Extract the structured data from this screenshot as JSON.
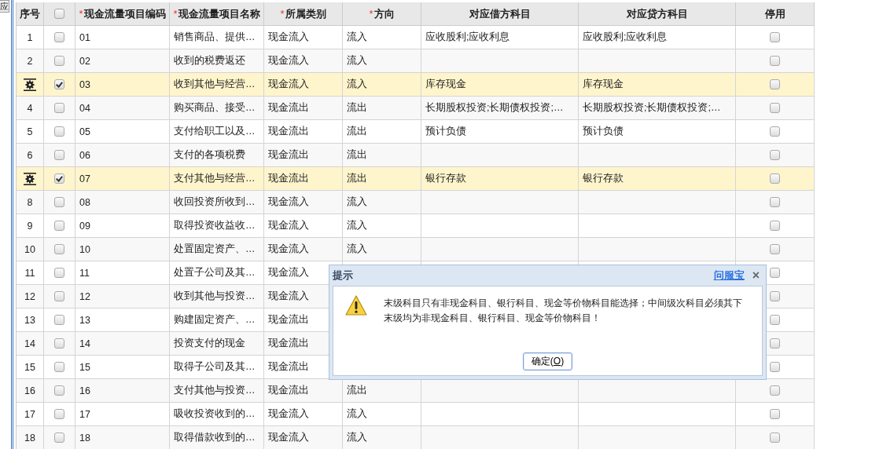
{
  "side_tab": {
    "label": "应"
  },
  "table": {
    "columns": [
      {
        "label": "序号"
      },
      {
        "kind": "checkbox",
        "checked": false
      },
      {
        "label": "现金流量项目编码",
        "required_mark": "*"
      },
      {
        "label": "现金流量项目名称",
        "required_mark": "*"
      },
      {
        "label": "所属类别",
        "required_mark": "*"
      },
      {
        "label": "方向",
        "required_mark": "*"
      },
      {
        "label": "对应借方科目"
      },
      {
        "label": "对应贷方科目"
      },
      {
        "label": "停用"
      }
    ],
    "rows": [
      {
        "index": "1",
        "selected": false,
        "code": "01",
        "name": "销售商品、提供…",
        "category": "现金流入",
        "direction": "流入",
        "debit": "应收股利;应收利息",
        "credit": "应收股利;应收利息",
        "disabled": false
      },
      {
        "index": "2",
        "selected": false,
        "code": "02",
        "name": "收到的税费返还",
        "category": "现金流入",
        "direction": "流入",
        "debit": "",
        "credit": "",
        "disabled": false
      },
      {
        "selected": true,
        "code": "03",
        "name": "收到其他与经营…",
        "category": "现金流入",
        "direction": "流入",
        "debit": "库存现金",
        "credit": "库存现金",
        "disabled": false
      },
      {
        "index": "4",
        "selected": false,
        "code": "04",
        "name": "购买商品、接受…",
        "category": "现金流出",
        "direction": "流出",
        "debit": "长期股权投资;长期债权投资;…",
        "credit": "长期股权投资;长期债权投资;…",
        "disabled": false
      },
      {
        "index": "5",
        "selected": false,
        "code": "05",
        "name": "支付给职工以及…",
        "category": "现金流出",
        "direction": "流出",
        "debit": "预计负债",
        "credit": "预计负债",
        "disabled": false
      },
      {
        "index": "6",
        "selected": false,
        "code": "06",
        "name": "支付的各项税费",
        "category": "现金流出",
        "direction": "流出",
        "debit": "",
        "credit": "",
        "disabled": false
      },
      {
        "selected": true,
        "code": "07",
        "name": "支付其他与经营…",
        "category": "现金流出",
        "direction": "流出",
        "debit": "银行存款",
        "credit": "银行存款",
        "disabled": false
      },
      {
        "index": "8",
        "selected": false,
        "code": "08",
        "name": "收回投资所收到…",
        "category": "现金流入",
        "direction": "流入",
        "debit": "",
        "credit": "",
        "disabled": false
      },
      {
        "index": "9",
        "selected": false,
        "code": "09",
        "name": "取得投资收益收…",
        "category": "现金流入",
        "direction": "流入",
        "debit": "",
        "credit": "",
        "disabled": false
      },
      {
        "index": "10",
        "selected": false,
        "code": "10",
        "name": "处置固定资产、…",
        "category": "现金流入",
        "direction": "流入",
        "debit": "",
        "credit": "",
        "disabled": false
      },
      {
        "index": "11",
        "selected": false,
        "code": "11",
        "name": "处置子公司及其…",
        "category": "现金流入",
        "direction": "",
        "debit": "",
        "credit": "",
        "disabled": false
      },
      {
        "index": "12",
        "selected": false,
        "code": "12",
        "name": "收到其他与投资…",
        "category": "现金流入",
        "direction": "",
        "debit": "",
        "credit": "",
        "disabled": false
      },
      {
        "index": "13",
        "selected": false,
        "code": "13",
        "name": "购建固定资产、…",
        "category": "现金流出",
        "direction": "",
        "debit": "",
        "credit": "",
        "disabled": false
      },
      {
        "index": "14",
        "selected": false,
        "code": "14",
        "name": "投资支付的现金",
        "category": "现金流出",
        "direction": "",
        "debit": "",
        "credit": "",
        "disabled": false
      },
      {
        "index": "15",
        "selected": false,
        "code": "15",
        "name": "取得子公司及其…",
        "category": "现金流出",
        "direction": "",
        "debit": "",
        "credit": "",
        "disabled": false
      },
      {
        "index": "16",
        "selected": false,
        "code": "16",
        "name": "支付其他与投资…",
        "category": "现金流出",
        "direction": "流出",
        "debit": "",
        "credit": "",
        "disabled": false
      },
      {
        "index": "17",
        "selected": false,
        "code": "17",
        "name": "吸收投资收到的…",
        "category": "现金流入",
        "direction": "流入",
        "debit": "",
        "credit": "",
        "disabled": false
      },
      {
        "index": "18",
        "selected": false,
        "code": "18",
        "name": "取得借款收到的…",
        "category": "现金流入",
        "direction": "流入",
        "debit": "",
        "credit": "",
        "disabled": false
      }
    ]
  },
  "dialog": {
    "title": "提示",
    "help_link": "问服宝",
    "close": "×",
    "message": "末级科目只有非现金科目、银行科目、现金等价物科目能选择；中间级次科目必须其下末级均为非现金科目、银行科目、现金等价物科目！",
    "button": {
      "before": "确定(",
      "access_key": "O",
      "after": ")"
    }
  }
}
